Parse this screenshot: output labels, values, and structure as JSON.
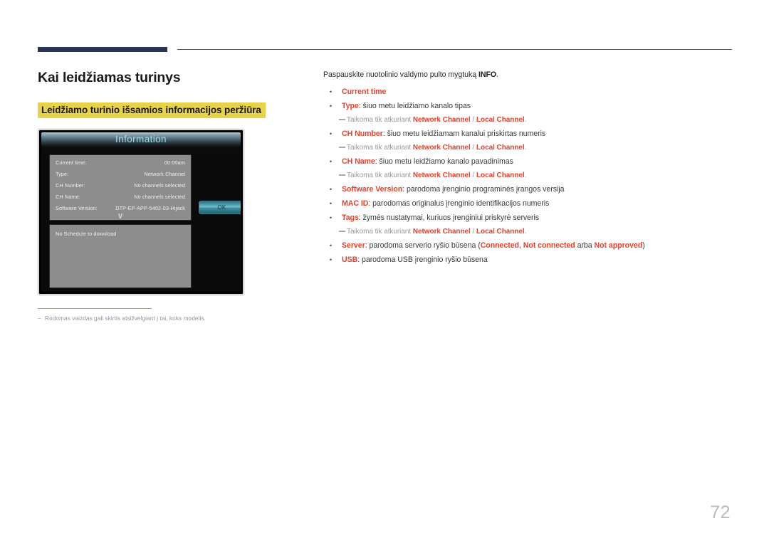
{
  "page": {
    "number": "72"
  },
  "headings": {
    "h1": "Kai leidžiamas turinys",
    "h2": "Leidžiamo turinio išsamios informacijos peržiūra"
  },
  "colors": {
    "navy_rule": "#2b3450",
    "highlight_yellow": "#e6d34a",
    "accent_red": "#e8412b",
    "note_gray": "#9a9a9a",
    "panel_gray": "#8d8d8d",
    "title_cyan": "#9fdfe8"
  },
  "tv_dialog": {
    "title": "Information",
    "rows": [
      {
        "label": "Current time:",
        "value": "00:00am"
      },
      {
        "label": "Type:",
        "value": "Network Channel"
      },
      {
        "label": "CH Number:",
        "value": "No channels selected"
      },
      {
        "label": "CH Name:",
        "value": "No channels selected"
      },
      {
        "label": "Software Version:",
        "value": "DTP-EP-APP-5402-03-Hijack"
      }
    ],
    "expand_chevron": "∨",
    "schedule_text": "No Schedule to download",
    "ok_label": "OK"
  },
  "footnote": {
    "dash": "–",
    "text": "Rodomas vaizdas gali skirtis atsižvelgiant į tai, koks modelis."
  },
  "content": {
    "lead_prefix": "Paspauskite nuotolinio valdymo pulto mygtuką ",
    "lead_bold": "INFO",
    "lead_suffix": ".",
    "subnote_prefix": "Taikoma tik atkuriant ",
    "subnote_channel_a": "Network Channel",
    "subnote_sep": " / ",
    "subnote_channel_b": "Local Channel",
    "subnote_suffix": ".",
    "items": [
      {
        "term": "Current time",
        "desc": ""
      },
      {
        "term": "Type",
        "desc": ": šiuo metu leidžiamo kanalo tipas"
      },
      {
        "term": "CH Number",
        "desc": ": šiuo metu leidžiamam kanalui priskirtas numeris"
      },
      {
        "term": "CH Name",
        "desc": ": šiuo metu leidžiamo kanalo pavadinimas"
      },
      {
        "term": "Software Version",
        "desc": ": parodoma įrenginio programinės įrangos versija"
      },
      {
        "term": "MAC ID",
        "desc": ": parodomas originalus įrenginio identifikacijos numeris"
      },
      {
        "term": "Tags",
        "desc": ": žymės nustatymai, kuriuos įrenginiui priskyrė serveris"
      },
      {
        "term": "USB",
        "desc": ": parodoma USB įrenginio ryšio būsena"
      }
    ],
    "server": {
      "term": "Server",
      "desc_a": ": parodoma serverio ryšio būsena (",
      "state_connected": "Connected",
      "desc_b": ", ",
      "state_not_connected": "Not connected",
      "desc_c": " arba ",
      "state_not_approved": "Not approved",
      "desc_d": ")"
    }
  }
}
